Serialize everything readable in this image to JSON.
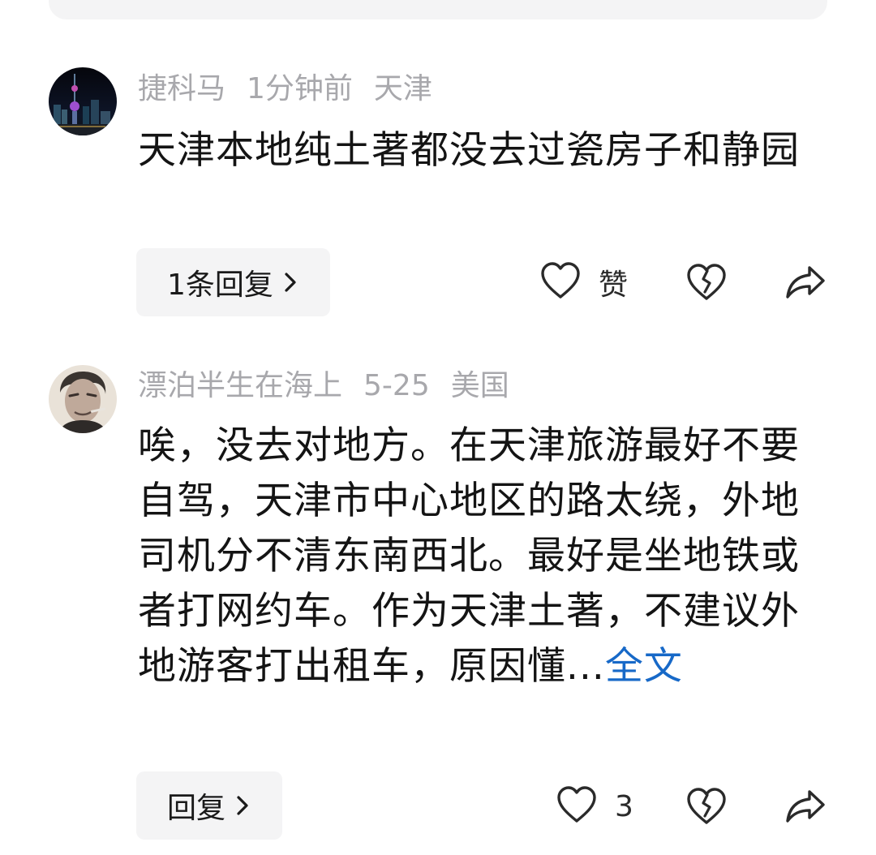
{
  "comments": [
    {
      "username": "捷科马",
      "time": "1分钟前",
      "location": "天津",
      "text": "天津本地纯土著都没去过瓷房子和静园",
      "more_label": "",
      "reply_label": "1条回复",
      "like_label": "赞",
      "avatar_icon": "city-night-skyline-avatar"
    },
    {
      "username": "漂泊半生在海上",
      "time": "5-25",
      "location": "美国",
      "text": "唉，没去对地方。在天津旅游最好不要自驾，天津市中心地区的路太绕，外地司机分不清东南西北。最好是坐地铁或者打网约车。作为天津土著，不建议外地游客打出租车，原因懂...",
      "more_label": "全文",
      "reply_label": "回复",
      "like_label": "3",
      "avatar_icon": "elderly-man-portrait-avatar"
    }
  ],
  "icons": {
    "like": "heart-outline-icon",
    "dislike": "broken-heart-icon",
    "share": "share-arrow-icon",
    "chevron": "chevron-right-icon"
  },
  "colors": {
    "meta_text": "#a8a8ac",
    "body_text": "#141414",
    "link": "#1769c8",
    "reply_bg": "#f4f4f5",
    "icon_stroke": "#2a2a2a"
  }
}
